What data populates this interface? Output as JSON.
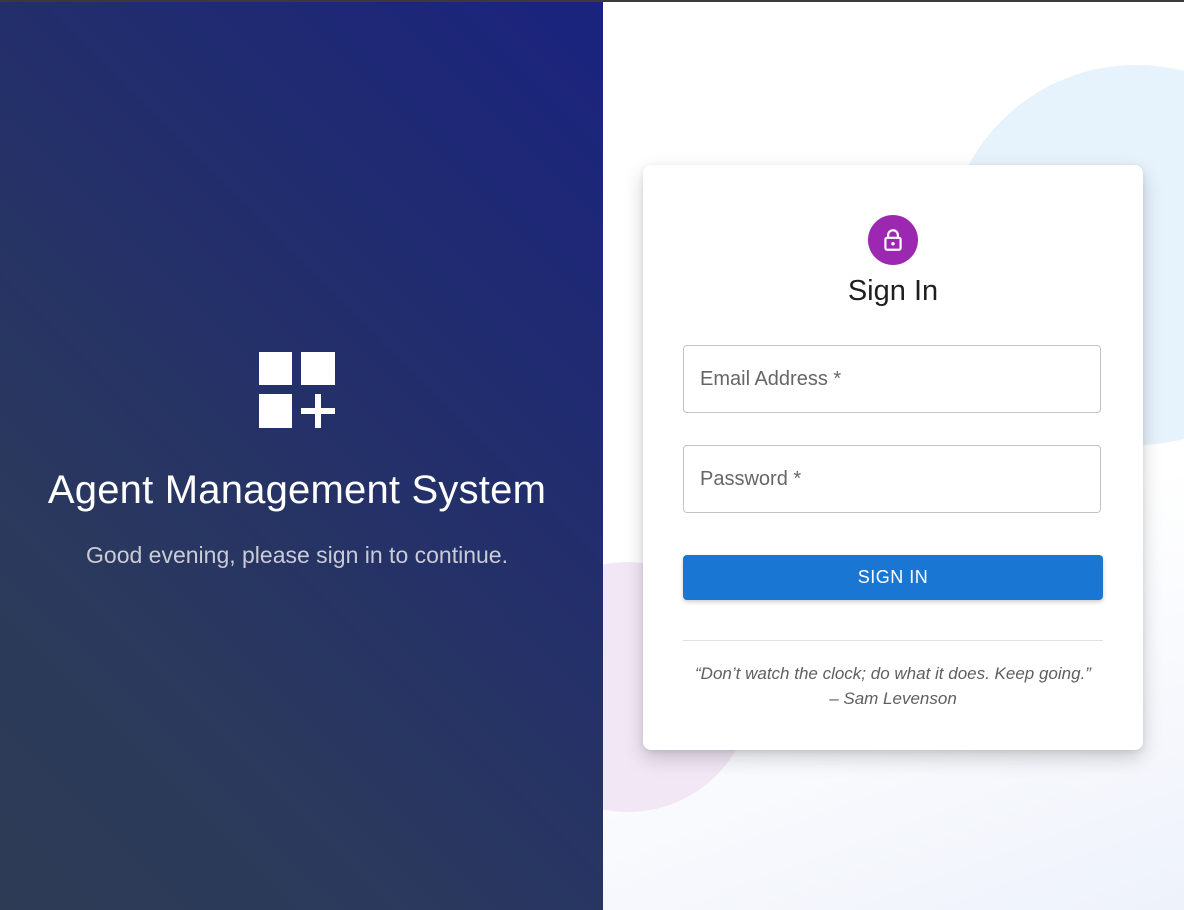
{
  "left": {
    "title": "Agent Management System",
    "greeting": "Good evening, please sign in to continue.",
    "logo_icon": "dashboard-add-icon"
  },
  "card": {
    "avatar_icon": "lock-icon",
    "title": "Sign In",
    "email": {
      "placeholder": "Email Address *",
      "value": ""
    },
    "password": {
      "placeholder": "Password *",
      "value": ""
    },
    "submit_label": "SIGN IN",
    "quote": "“Don’t watch the clock; do what it does. Keep going.”",
    "quote_author": "– Sam Levenson"
  },
  "colors": {
    "accent": "#1976d2",
    "avatar": "#9c27b0",
    "left_panel": "#1a237e"
  }
}
